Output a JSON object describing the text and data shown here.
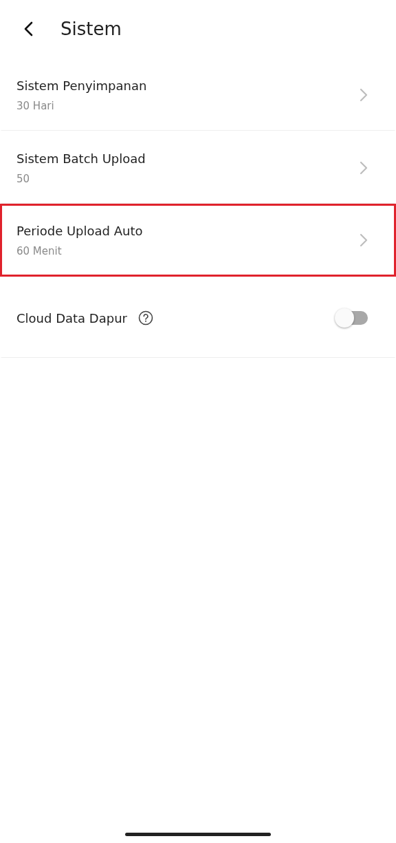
{
  "header": {
    "title": "Sistem"
  },
  "items": [
    {
      "kind": "link",
      "title": "Sistem Penyimpanan",
      "value": "30 Hari",
      "highlighted": false
    },
    {
      "kind": "link",
      "title": "Sistem Batch Upload",
      "value": "50",
      "highlighted": false
    },
    {
      "kind": "link",
      "title": "Periode Upload Auto",
      "value": "60 Menit",
      "highlighted": true
    },
    {
      "kind": "toggle",
      "title": "Cloud Data Dapur",
      "on": false,
      "highlighted": false
    }
  ]
}
